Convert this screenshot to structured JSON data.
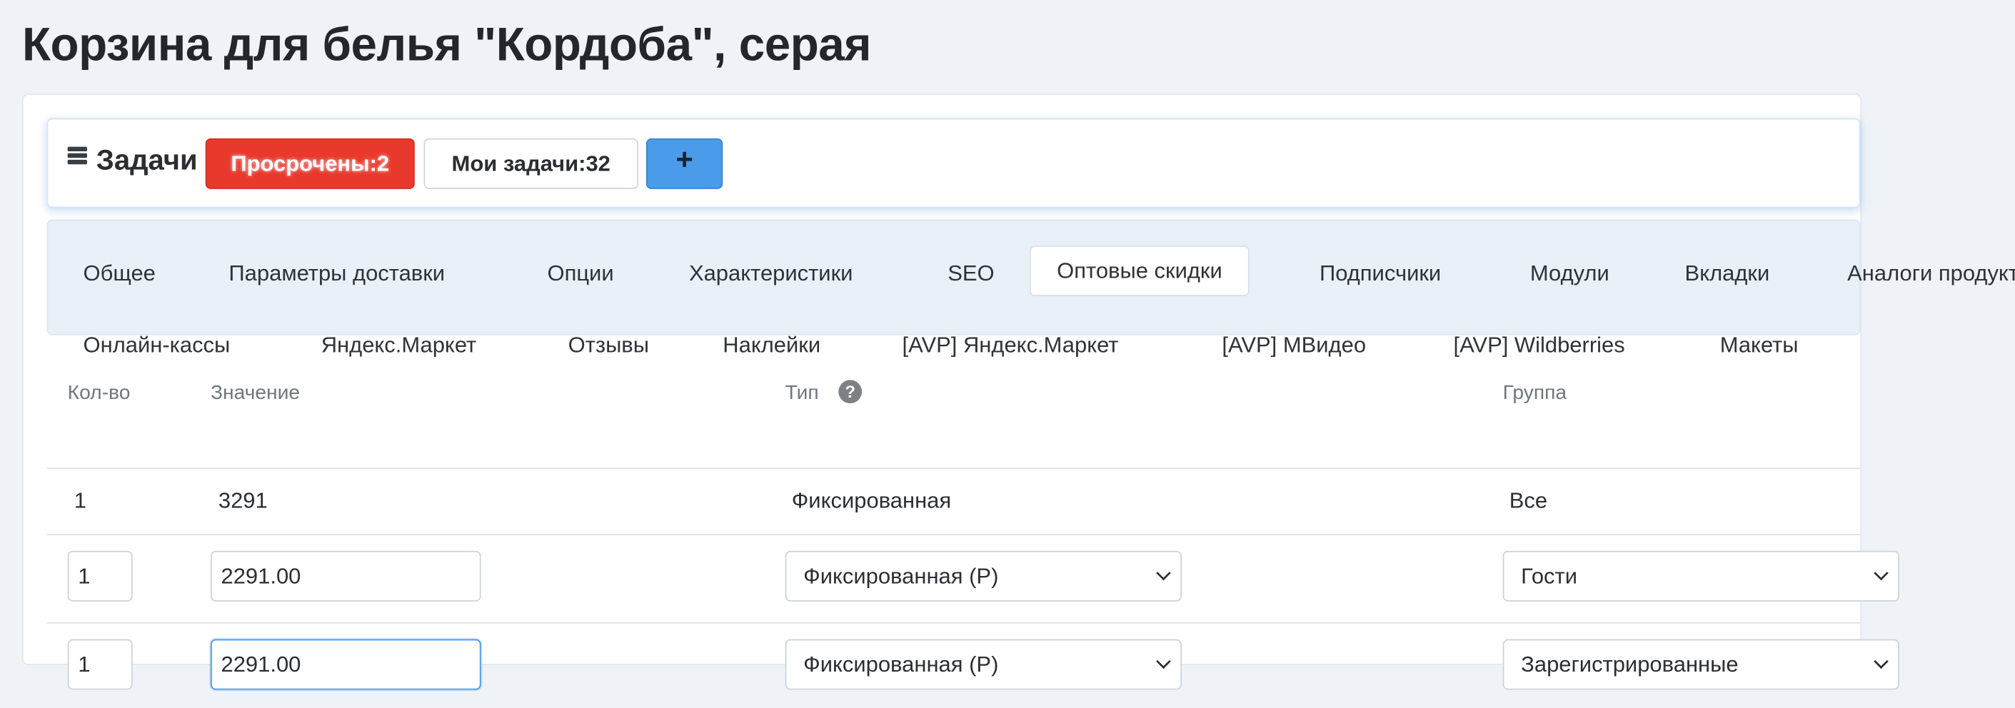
{
  "page": {
    "title": "Корзина для белья \"Кордоба\", серая"
  },
  "tasks": {
    "title": "Задачи",
    "overdue_label": "Просрочены:2",
    "my_tasks_label": "Мои задачи:32",
    "add_label": "+"
  },
  "tabs": [
    {
      "label": "Общее"
    },
    {
      "label": "Параметры доставки"
    },
    {
      "label": "Опции"
    },
    {
      "label": "Характеристики"
    },
    {
      "label": "SEO"
    },
    {
      "label": "Оптовые скидки",
      "active": true
    },
    {
      "label": "Подписчики"
    },
    {
      "label": "Модули"
    },
    {
      "label": "Вкладки"
    },
    {
      "label": "Аналоги продуктов"
    },
    {
      "label": "Онлайн-кассы"
    },
    {
      "label": "Яндекс.Маркет"
    },
    {
      "label": "Отзывы"
    },
    {
      "label": "Наклейки"
    },
    {
      "label": "[AVP] Яндекс.Маркет"
    },
    {
      "label": "[AVP] МВидео"
    },
    {
      "label": "[AVP] Wildberries"
    },
    {
      "label": "Макеты"
    }
  ],
  "table": {
    "headers": {
      "qty": "Кол-во",
      "value": "Значение",
      "type": "Тип",
      "group": "Группа"
    },
    "help_glyph": "?",
    "rows": [
      {
        "qty": "1",
        "value": "3291",
        "type": "Фиксированная",
        "group": "Все"
      },
      {
        "qty": "1",
        "value": "2291.00",
        "type": "Фиксированная (Р)",
        "group": "Гости"
      },
      {
        "qty": "1",
        "value": "2291.00",
        "type": "Фиксированная (Р)",
        "group": "Зарегистрированные"
      }
    ]
  },
  "colors": {
    "accent": "#4a9be9",
    "danger": "#e8392c",
    "background": "#eff3f8"
  }
}
